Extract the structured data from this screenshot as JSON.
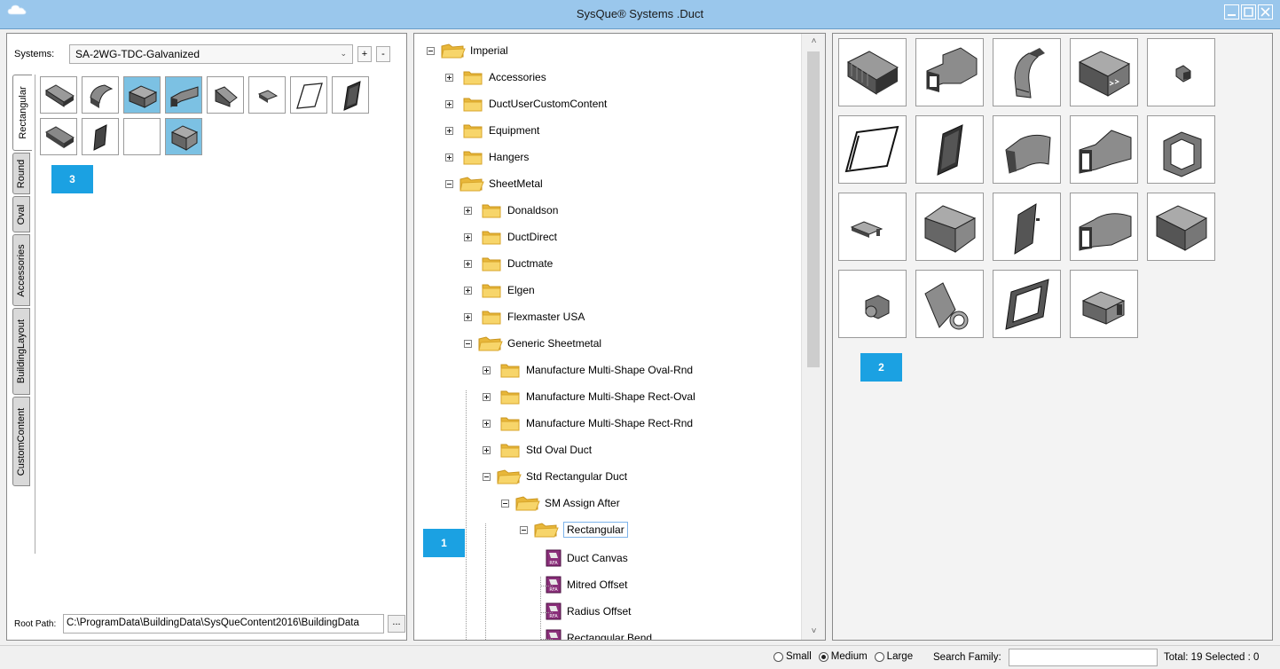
{
  "window": {
    "title": "SysQue® Systems .Duct",
    "controls": [
      "minimize-icon",
      "maximize-icon",
      "close-icon"
    ]
  },
  "left_panel": {
    "systems_label": "Systems:",
    "systems_value": "SA-2WG-TDC-Galvanized",
    "add_label": "+",
    "remove_label": "-",
    "tabs": [
      "Rectangular",
      "Round",
      "Oval",
      "Accessories",
      "BuildingLayout",
      "CustomContent"
    ],
    "active_tab": "Rectangular",
    "root_path_label": "Root Path:",
    "root_path_value": "C:\\ProgramData\\BuildingData\\SysQueContent2016\\BuildingData",
    "browse_label": "..."
  },
  "badges": {
    "tree": "1",
    "families": "2",
    "favorites": "3"
  },
  "tree": {
    "nodes": [
      {
        "label": "Imperial",
        "depth": 0,
        "state": "expanded"
      },
      {
        "label": "Accessories",
        "depth": 1,
        "state": "collapsed"
      },
      {
        "label": "DuctUserCustomContent",
        "depth": 1,
        "state": "collapsed"
      },
      {
        "label": "Equipment",
        "depth": 1,
        "state": "collapsed"
      },
      {
        "label": "Hangers",
        "depth": 1,
        "state": "collapsed"
      },
      {
        "label": "SheetMetal",
        "depth": 1,
        "state": "expanded"
      },
      {
        "label": "Donaldson",
        "depth": 2,
        "state": "collapsed"
      },
      {
        "label": "DuctDirect",
        "depth": 2,
        "state": "collapsed"
      },
      {
        "label": "Ductmate",
        "depth": 2,
        "state": "collapsed"
      },
      {
        "label": "Elgen",
        "depth": 2,
        "state": "collapsed"
      },
      {
        "label": "Flexmaster USA",
        "depth": 2,
        "state": "collapsed"
      },
      {
        "label": "Generic Sheetmetal",
        "depth": 2,
        "state": "expanded"
      },
      {
        "label": "Manufacture Multi-Shape Oval-Rnd",
        "depth": 3,
        "state": "collapsed"
      },
      {
        "label": "Manufacture Multi-Shape Rect-Oval",
        "depth": 3,
        "state": "collapsed"
      },
      {
        "label": "Manufacture Multi-Shape Rect-Rnd",
        "depth": 3,
        "state": "collapsed"
      },
      {
        "label": "Std Oval Duct",
        "depth": 3,
        "state": "collapsed"
      },
      {
        "label": "Std Rectangular Duct",
        "depth": 3,
        "state": "expanded"
      },
      {
        "label": "SM Assign After",
        "depth": 4,
        "state": "expanded"
      },
      {
        "label": "Rectangular",
        "depth": 5,
        "state": "expanded",
        "selected": true
      },
      {
        "label": "Duct Canvas",
        "depth": 6,
        "state": "file"
      },
      {
        "label": "Mitred Offset",
        "depth": 6,
        "state": "file"
      },
      {
        "label": "Radius Offset",
        "depth": 6,
        "state": "file"
      },
      {
        "label": "Rectangular Bend",
        "depth": 6,
        "state": "file"
      }
    ]
  },
  "status": {
    "size_options": [
      "Small",
      "Medium",
      "Large"
    ],
    "size_selected": "Medium",
    "search_label": "Search Family:",
    "search_value": "",
    "totals": "Total: 19 Selected : 0"
  },
  "colors": {
    "titlebar": "#9ac7ec",
    "badge": "#1ba1e2",
    "selected_thumb": "#7cc1e3",
    "folder": "#f7c948"
  }
}
